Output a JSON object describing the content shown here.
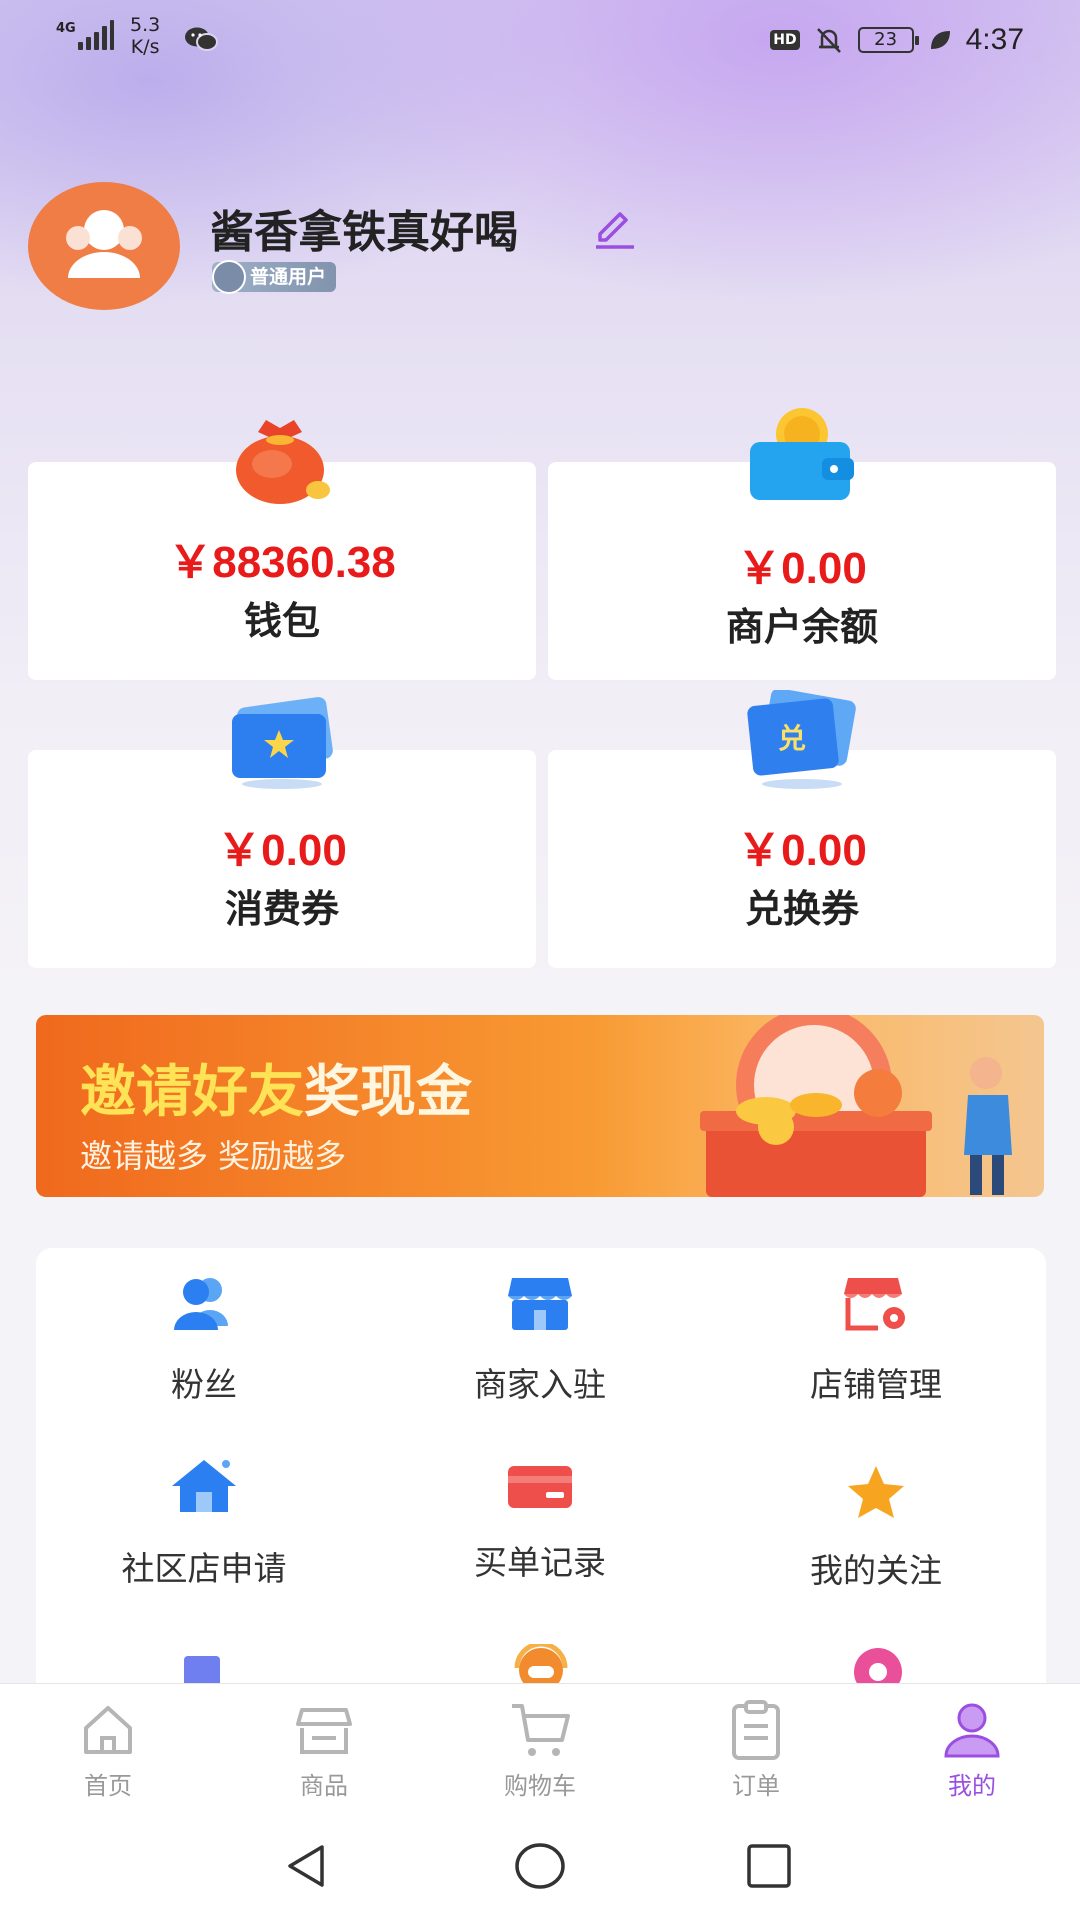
{
  "status_bar": {
    "network": "4G",
    "speed_value": "5.3",
    "speed_unit": "K/s",
    "hd": "HD",
    "battery": "23",
    "time": "4:37"
  },
  "profile": {
    "username": "酱香拿铁真好喝",
    "badge": "普通用户"
  },
  "cards": [
    {
      "amount": "￥88360.38",
      "label": "钱包",
      "icon": "money-bag-icon"
    },
    {
      "amount": "￥0.00",
      "label": "商户余额",
      "icon": "wallet-icon"
    },
    {
      "amount": "￥0.00",
      "label": "消费券",
      "icon": "coupon-icon"
    },
    {
      "amount": "￥0.00",
      "label": "兑换券",
      "icon": "exchange-coupon-icon"
    }
  ],
  "banner": {
    "title_part1": "邀请好友",
    "title_part2": "奖现金",
    "subtitle": "邀请越多 奖励越多"
  },
  "menu": [
    {
      "label": "粉丝",
      "icon": "users-icon"
    },
    {
      "label": "商家入驻",
      "icon": "store-icon"
    },
    {
      "label": "店铺管理",
      "icon": "store-settings-icon"
    },
    {
      "label": "社区店申请",
      "icon": "home-icon"
    },
    {
      "label": "买单记录",
      "icon": "card-icon"
    },
    {
      "label": "我的关注",
      "icon": "star-icon"
    }
  ],
  "bottom_nav": [
    {
      "label": "首页",
      "icon": "home-nav-icon",
      "active": false
    },
    {
      "label": "商品",
      "icon": "shop-nav-icon",
      "active": false
    },
    {
      "label": "购物车",
      "icon": "cart-nav-icon",
      "active": false
    },
    {
      "label": "订单",
      "icon": "order-nav-icon",
      "active": false
    },
    {
      "label": "我的",
      "icon": "profile-nav-icon",
      "active": true
    }
  ],
  "colors": {
    "accent": "#9b4fe0",
    "amount_red": "#e81a1a",
    "avatar_orange": "#ef7d45"
  }
}
